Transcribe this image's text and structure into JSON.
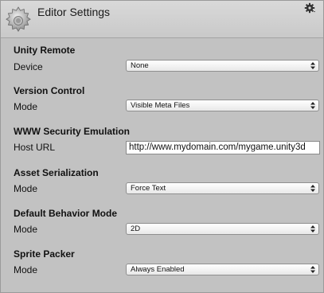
{
  "window": {
    "title": "Editor Settings",
    "icon": "gear-icon",
    "menu_icon": "gear-menu-icon"
  },
  "sections": [
    {
      "title": "Unity Remote",
      "field_label": "Device",
      "value": "None",
      "kind": "dropdown"
    },
    {
      "title": "Version Control",
      "field_label": "Mode",
      "value": "Visible Meta Files",
      "kind": "dropdown"
    },
    {
      "title": "WWW Security Emulation",
      "field_label": "Host URL",
      "value": "http://www.mydomain.com/mygame.unity3d",
      "kind": "textfield"
    },
    {
      "title": "Asset Serialization",
      "field_label": "Mode",
      "value": "Force Text",
      "kind": "dropdown"
    },
    {
      "title": "Default Behavior Mode",
      "field_label": "Mode",
      "value": "2D",
      "kind": "dropdown"
    },
    {
      "title": "Sprite Packer",
      "field_label": "Mode",
      "value": "Always Enabled",
      "kind": "dropdown"
    }
  ]
}
